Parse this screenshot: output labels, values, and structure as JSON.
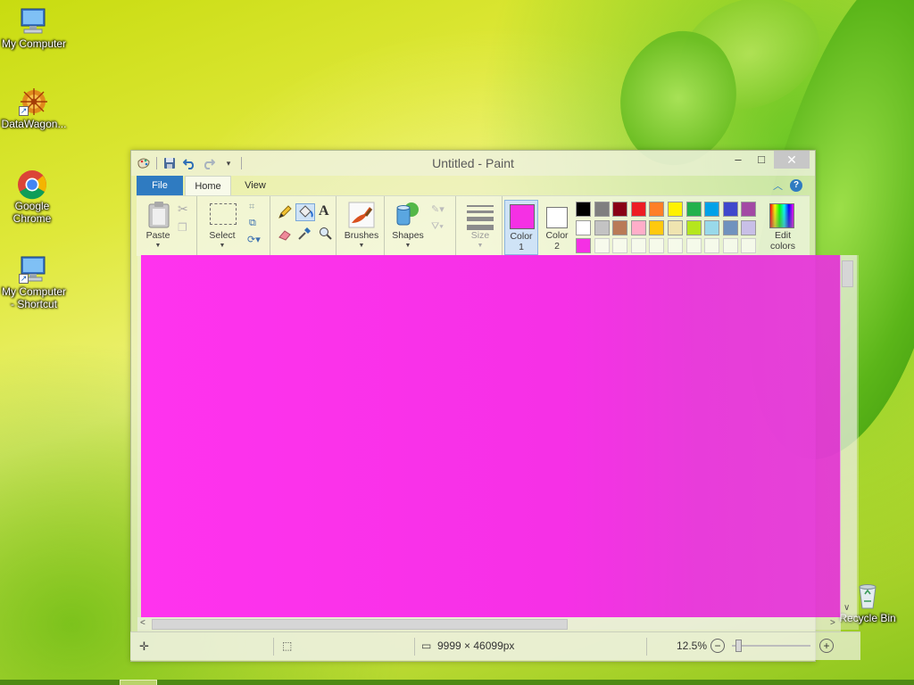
{
  "desktop": {
    "icons": [
      {
        "label_line1": "My Computer",
        "label_line2": "",
        "icon": "computer-icon"
      },
      {
        "label_line1": "DataWagon...",
        "label_line2": "",
        "icon": "datawagon-icon"
      },
      {
        "label_line1": "Google",
        "label_line2": "Chrome",
        "icon": "chrome-icon"
      },
      {
        "label_line1": "My Computer",
        "label_line2": "- Shortcut",
        "icon": "computer-shortcut-icon"
      },
      {
        "label_line1": "Recycle Bin",
        "label_line2": "",
        "icon": "recycle-bin-icon"
      }
    ]
  },
  "window": {
    "title": "Untitled - Paint",
    "controls": {
      "minimize": "–",
      "maximize": "□",
      "close": "✕"
    },
    "tabs": {
      "file": "File",
      "home": "Home",
      "view": "View"
    }
  },
  "ribbon": {
    "clipboard": {
      "paste": "Paste"
    },
    "image": {
      "select": "Select"
    },
    "tools": {
      "text_tool": "A"
    },
    "brushes": "Brushes",
    "shapes": "Shapes",
    "size": "Size",
    "color1": {
      "line1": "Color",
      "line2": "1",
      "value": "#f530e4"
    },
    "color2": {
      "line1": "Color",
      "line2": "2",
      "value": "#ffffff"
    },
    "edit_colors": {
      "line1": "Edit",
      "line2": "colors"
    },
    "palette": {
      "row1": [
        "#000000",
        "#7f7f7f",
        "#880015",
        "#ed1c24",
        "#ff7f27",
        "#fff200",
        "#22b14c",
        "#00a2e8",
        "#3f48cc",
        "#a349a4"
      ],
      "row2": [
        "#ffffff",
        "#c3c3c3",
        "#b97a57",
        "#ffaec9",
        "#ffc90e",
        "#efe4b0",
        "#b5e61d",
        "#99d9ea",
        "#7092be",
        "#c8bfe7"
      ],
      "row3": [
        "#f530e4",
        "#ffffff",
        "#ffffff",
        "#ffffff",
        "#ffffff",
        "#ffffff",
        "#ffffff",
        "#ffffff",
        "#ffffff",
        "#ffffff"
      ]
    }
  },
  "canvas": {
    "fill_color": "#f530e4"
  },
  "statusbar": {
    "image_size": "9999 × 46099px",
    "zoom": "12.5%",
    "zoom_out": "−",
    "zoom_in": "+"
  }
}
